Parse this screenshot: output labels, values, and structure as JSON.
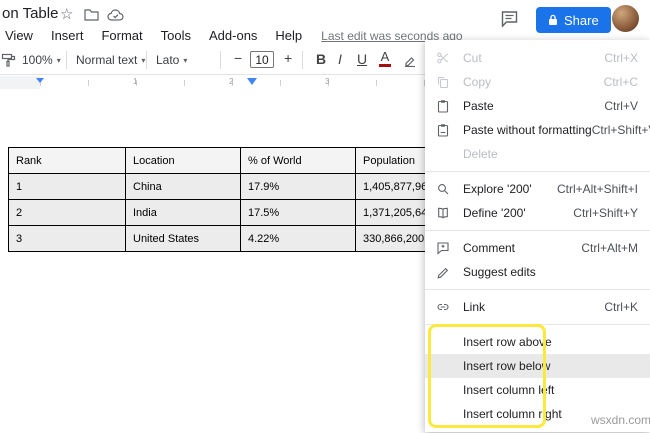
{
  "window": {
    "title": "on Table"
  },
  "menubar": {
    "items": [
      "View",
      "Insert",
      "Format",
      "Tools",
      "Add-ons",
      "Help"
    ],
    "last_edit": "Last edit was seconds ago"
  },
  "actions": {
    "share_label": "Share"
  },
  "toolbar": {
    "zoom": "100%",
    "style": "Normal text",
    "font": "Lato",
    "font_size": "10",
    "minus": "−",
    "plus": "+",
    "bold": "B",
    "italic": "I",
    "underline": "U",
    "text_color": "A",
    "caret": "▾"
  },
  "ruler": {
    "marks": [
      "1",
      "2",
      "3"
    ]
  },
  "table": {
    "headers": [
      "Rank",
      "Location",
      "% of World",
      "Population"
    ],
    "rows": [
      [
        "1",
        "China",
        "17.9%",
        "1,405,877,96"
      ],
      [
        "2",
        "India",
        "17.5%",
        "1,371,205,64"
      ],
      [
        "3",
        "United States",
        "4.22%",
        "330,866,200"
      ]
    ]
  },
  "menu": {
    "items": [
      {
        "label": "Cut",
        "shortcut": "Ctrl+X",
        "disabled": true
      },
      {
        "label": "Copy",
        "shortcut": "Ctrl+C",
        "disabled": true
      },
      {
        "label": "Paste",
        "shortcut": "Ctrl+V"
      },
      {
        "label": "Paste without formatting",
        "shortcut": "Ctrl+Shift+V"
      },
      {
        "label": "Delete",
        "shortcut": "",
        "disabled": true
      },
      {
        "label": "Explore '200'",
        "shortcut": "Ctrl+Alt+Shift+I"
      },
      {
        "label": "Define '200'",
        "shortcut": "Ctrl+Shift+Y"
      },
      {
        "label": "Comment",
        "shortcut": "Ctrl+Alt+M"
      },
      {
        "label": "Suggest edits",
        "shortcut": ""
      },
      {
        "label": "Link",
        "shortcut": "Ctrl+K"
      },
      {
        "label": "Insert row above",
        "shortcut": ""
      },
      {
        "label": "Insert row below",
        "shortcut": "",
        "hovered": true
      },
      {
        "label": "Insert column left",
        "shortcut": ""
      },
      {
        "label": "Insert column right",
        "shortcut": ""
      }
    ]
  },
  "watermark": "wsxdn.com"
}
